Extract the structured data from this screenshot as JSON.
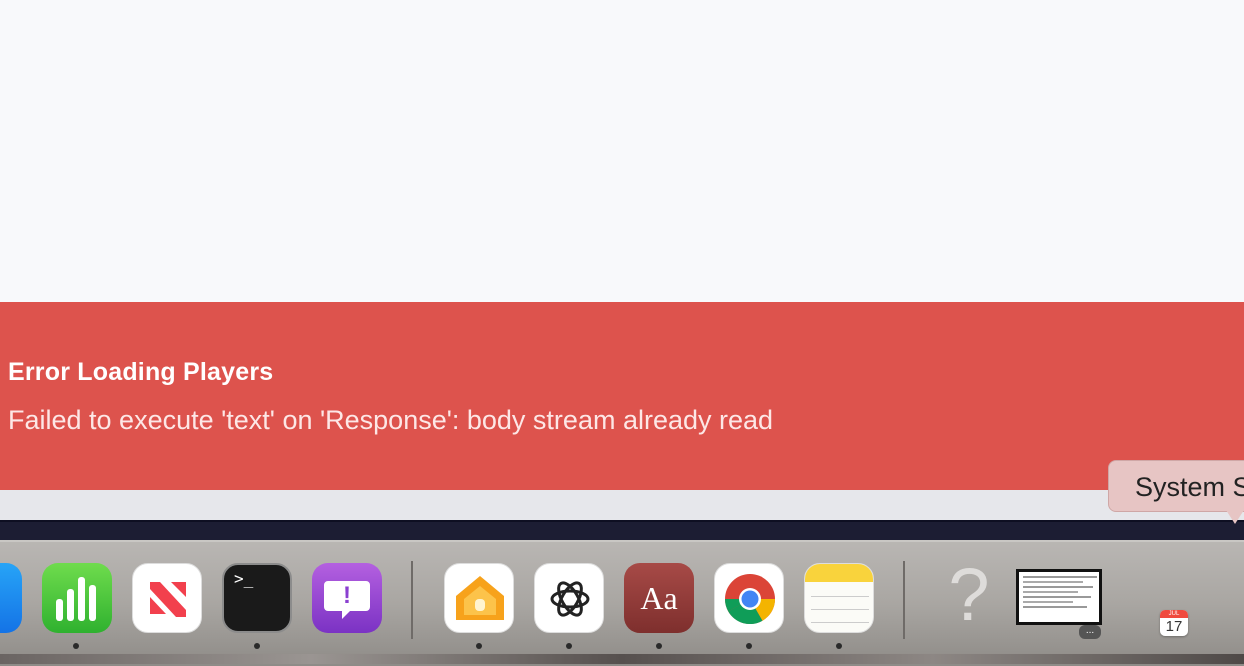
{
  "error": {
    "title": "Error Loading Players",
    "message": "Failed to execute 'text' on 'Response': body stream already read"
  },
  "tooltip": {
    "label": "System S"
  },
  "dock": {
    "apps": [
      {
        "name": "app-store-icon"
      },
      {
        "name": "numbers-icon"
      },
      {
        "name": "news-icon"
      },
      {
        "name": "terminal-icon",
        "glyph": ">_"
      },
      {
        "name": "feedback-assistant-icon",
        "glyph": "!"
      },
      {
        "name": "home-icon"
      },
      {
        "name": "chatgpt-icon"
      },
      {
        "name": "dictionary-icon",
        "glyph": "Aa"
      },
      {
        "name": "chrome-icon"
      },
      {
        "name": "notes-icon"
      },
      {
        "name": "unknown-app-icon",
        "glyph": "?"
      },
      {
        "name": "window-thumbnail-icon",
        "badge": "..."
      },
      {
        "name": "calendar-icon",
        "month": "JUL",
        "day": "17"
      }
    ]
  },
  "colors": {
    "error_bg": "#dd534d",
    "page_bg": "#f8f9fb",
    "tooltip_bg": "#e7c5c4"
  }
}
